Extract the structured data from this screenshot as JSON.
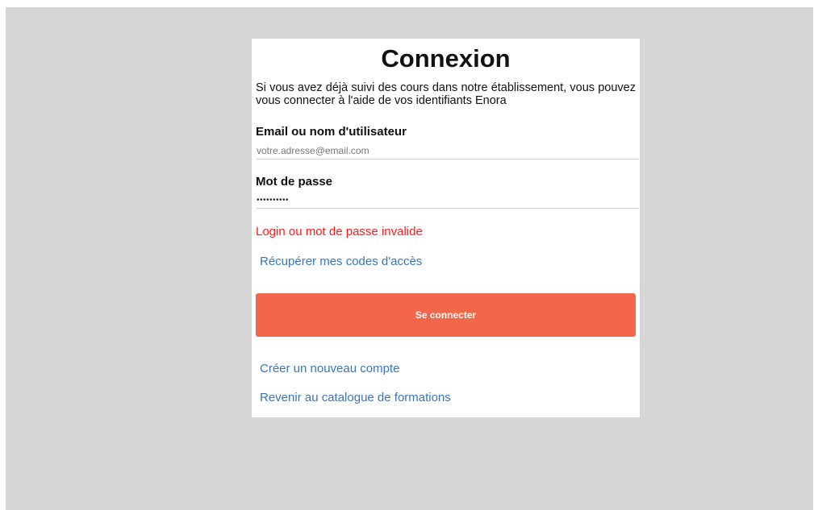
{
  "login": {
    "title": "Connexion",
    "intro": "Si vous avez déjà suivi des cours dans notre établissement, vous pouvez vous connecter à l'aide de vos identifiants Enora",
    "email_label": "Email ou nom d'utilisateur",
    "email_placeholder": "votre.adresse@email.com",
    "email_value": "",
    "password_label": "Mot de passe",
    "password_value": "••••••••••",
    "error_message": "Login ou mot de passe invalide",
    "recover_link": "Récupérer mes codes d'accès",
    "submit_label": "Se connecter",
    "create_account_link": "Créer un nouveau compte",
    "catalog_link": "Revenir au catalogue de formations"
  },
  "colors": {
    "backdrop": "#d6d6d6",
    "card": "#ffffff",
    "button": "#f26649",
    "error": "#ff1a1a",
    "link": "#3a75b6"
  }
}
